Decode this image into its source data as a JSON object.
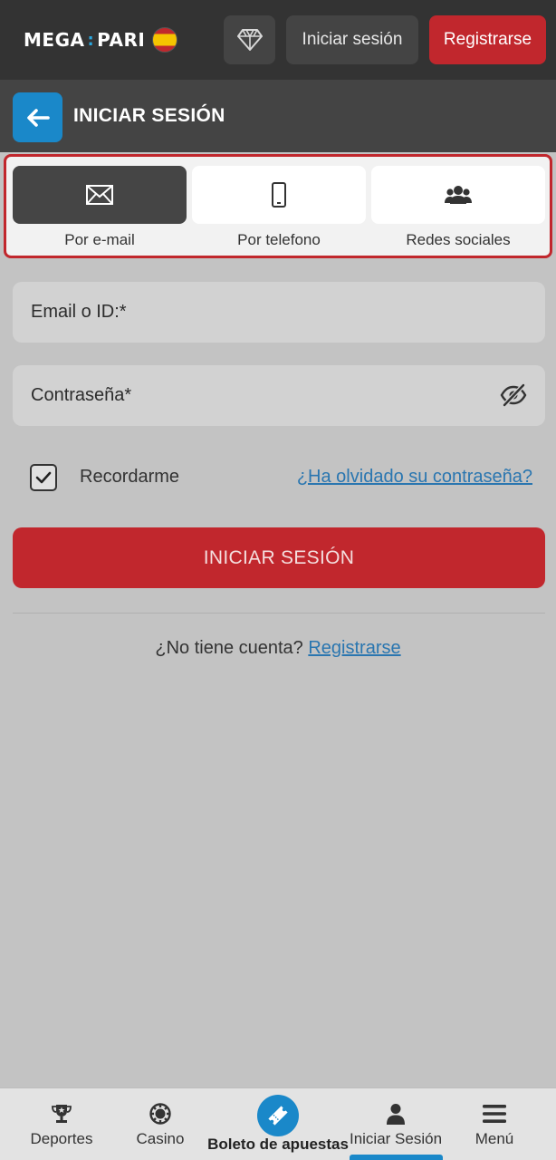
{
  "header": {
    "logo_left": "MEGA",
    "logo_sep": ":",
    "logo_right": "PARI",
    "login_label": "Iniciar sesión",
    "register_label": "Registrarse"
  },
  "title_bar": {
    "title": "INICIAR SESIÓN"
  },
  "methods": [
    {
      "label": "Por e-mail",
      "icon": "envelope-icon",
      "active": true
    },
    {
      "label": "Por telefono",
      "icon": "phone-icon",
      "active": false
    },
    {
      "label": "Redes sociales",
      "icon": "users-icon",
      "active": false
    }
  ],
  "form": {
    "email_placeholder": "Email o ID:*",
    "password_placeholder": "Contraseña*",
    "remember_label": "Recordarme",
    "remember_checked": true,
    "forgot_label": "¿Ha olvidado su contraseña?",
    "submit_label": "INICIAR SESIÓN",
    "no_account_text": "¿No tiene cuenta?",
    "register_link": "Registrarse"
  },
  "bottom_nav": {
    "sports": "Deportes",
    "casino": "Casino",
    "betslip": "Boleto de apuestas",
    "login": "Iniciar Sesión",
    "menu": "Menú"
  },
  "colors": {
    "accent_red": "#c1272d",
    "accent_blue": "#1a88c9",
    "header_dark": "#333333",
    "background": "#c3c3c3"
  }
}
